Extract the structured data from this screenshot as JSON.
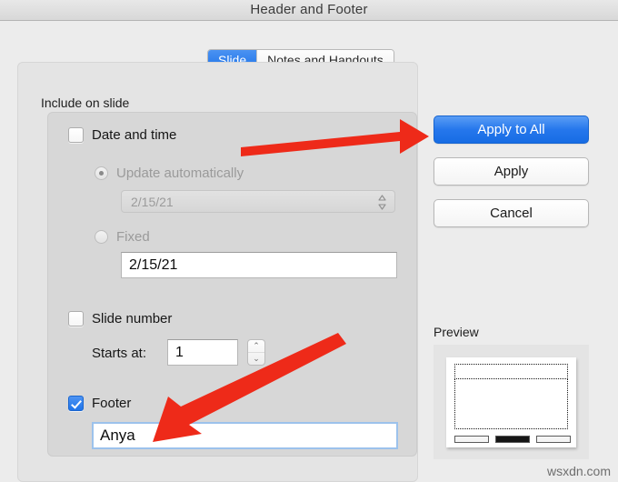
{
  "window": {
    "title": "Header and Footer"
  },
  "tabs": [
    {
      "label": "Slide",
      "active": true
    },
    {
      "label": "Notes and Handouts",
      "active": false
    }
  ],
  "include_section": {
    "label": "Include on slide",
    "date_and_time": {
      "checkbox_label": "Date and time",
      "checked": false,
      "update_automatically": {
        "label": "Update automatically",
        "selected": true,
        "value": "2/15/21"
      },
      "fixed": {
        "label": "Fixed",
        "selected": false,
        "value": "2/15/21"
      }
    },
    "slide_number": {
      "checkbox_label": "Slide number",
      "checked": false,
      "starts_at_label": "Starts at:",
      "starts_at_value": "1",
      "stepper_up": "⌃",
      "stepper_down": "⌄"
    },
    "footer": {
      "checkbox_label": "Footer",
      "checked": true,
      "value": "Anya"
    }
  },
  "buttons": {
    "apply_to_all": "Apply to All",
    "apply": "Apply",
    "cancel": "Cancel"
  },
  "preview": {
    "label": "Preview"
  },
  "watermark": "wsxdn.com",
  "colors": {
    "accent_blue": "#1e73e8",
    "arrow_red": "#ee2a19",
    "window_bg": "#ececec",
    "panel_bg": "#e4e4e4",
    "groupbox_bg": "#d7d7d7",
    "focus_ring": "#9cc2ec"
  },
  "icons": {
    "popup_arrows": "⇅",
    "checkmark": "✓"
  }
}
